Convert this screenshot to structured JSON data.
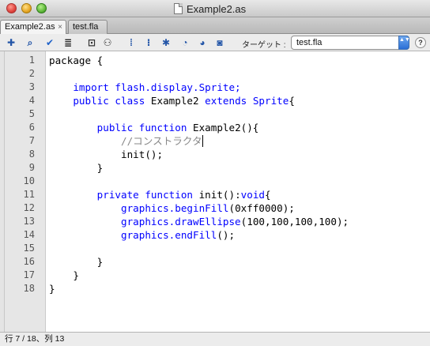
{
  "window": {
    "title": "Example2.as"
  },
  "tabs": [
    {
      "label": "Example2.as",
      "close": "×",
      "active": true
    },
    {
      "label": "test.fla",
      "active": false
    }
  ],
  "toolbar": {
    "icons": [
      {
        "name": "add-statement-icon",
        "glyph": "✚"
      },
      {
        "name": "find-icon",
        "glyph": "⌕"
      },
      {
        "name": "check-syntax-icon",
        "glyph": "✔"
      },
      {
        "name": "auto-format-icon",
        "glyph": "≣"
      },
      {
        "name": "code-hint-icon",
        "glyph": "⊡"
      },
      {
        "name": "debug-options-icon",
        "glyph": "⚇"
      },
      {
        "name": "collapse-between-braces-icon",
        "glyph": "⁞"
      },
      {
        "name": "collapse-selection-icon",
        "glyph": "⁝"
      },
      {
        "name": "expand-all-icon",
        "glyph": "✱"
      },
      {
        "name": "apply-block-comment-icon",
        "glyph": "◔"
      },
      {
        "name": "apply-line-comment-icon",
        "glyph": "◕"
      },
      {
        "name": "remove-comment-icon",
        "glyph": "◙"
      }
    ],
    "target_label": "ターゲット :",
    "target_value": "test.fla",
    "select_arrow": "▲▼",
    "help": "?"
  },
  "editor": {
    "line_numbers": [
      "1",
      "2",
      "3",
      "4",
      "5",
      "6",
      "7",
      "8",
      "9",
      "10",
      "11",
      "12",
      "13",
      "14",
      "15",
      "16",
      "17",
      "18"
    ],
    "lines": [
      {
        "segments": [
          {
            "t": "package {",
            "c": "plain"
          }
        ]
      },
      {
        "segments": []
      },
      {
        "segments": [
          {
            "t": "    ",
            "c": "plain"
          },
          {
            "t": "import flash.display.Sprite;",
            "c": "kw"
          }
        ]
      },
      {
        "segments": [
          {
            "t": "    ",
            "c": "plain"
          },
          {
            "t": "public class",
            "c": "kw"
          },
          {
            "t": " Example2 ",
            "c": "plain"
          },
          {
            "t": "extends",
            "c": "kw"
          },
          {
            "t": " ",
            "c": "plain"
          },
          {
            "t": "Sprite",
            "c": "kw"
          },
          {
            "t": "{",
            "c": "plain"
          }
        ]
      },
      {
        "segments": []
      },
      {
        "segments": [
          {
            "t": "        ",
            "c": "plain"
          },
          {
            "t": "public function",
            "c": "kw"
          },
          {
            "t": " Example2(){",
            "c": "plain"
          }
        ]
      },
      {
        "segments": [
          {
            "t": "            ",
            "c": "plain"
          },
          {
            "t": "//コンストラクタ",
            "c": "cm"
          }
        ],
        "caret": true
      },
      {
        "segments": [
          {
            "t": "            init();",
            "c": "plain"
          }
        ]
      },
      {
        "segments": [
          {
            "t": "        }",
            "c": "plain"
          }
        ]
      },
      {
        "segments": []
      },
      {
        "segments": [
          {
            "t": "        ",
            "c": "plain"
          },
          {
            "t": "private function",
            "c": "kw"
          },
          {
            "t": " init():",
            "c": "plain"
          },
          {
            "t": "void",
            "c": "kw"
          },
          {
            "t": "{",
            "c": "plain"
          }
        ]
      },
      {
        "segments": [
          {
            "t": "            ",
            "c": "plain"
          },
          {
            "t": "graphics.beginFill",
            "c": "kw"
          },
          {
            "t": "(0xff0000);",
            "c": "plain"
          }
        ]
      },
      {
        "segments": [
          {
            "t": "            ",
            "c": "plain"
          },
          {
            "t": "graphics.drawEllipse",
            "c": "kw"
          },
          {
            "t": "(100,100,100,100);",
            "c": "plain"
          }
        ]
      },
      {
        "segments": [
          {
            "t": "            ",
            "c": "plain"
          },
          {
            "t": "graphics.endFill",
            "c": "kw"
          },
          {
            "t": "();",
            "c": "plain"
          }
        ]
      },
      {
        "segments": []
      },
      {
        "segments": [
          {
            "t": "        }",
            "c": "plain"
          }
        ]
      },
      {
        "segments": [
          {
            "t": "    }",
            "c": "plain"
          }
        ]
      },
      {
        "segments": [
          {
            "t": "}",
            "c": "plain"
          }
        ]
      }
    ]
  },
  "status": {
    "text": "行 7 / 18、列 13"
  },
  "colors": {
    "keyword": "#0000ff",
    "comment": "#888888",
    "gutter": "#e6e6e6"
  }
}
